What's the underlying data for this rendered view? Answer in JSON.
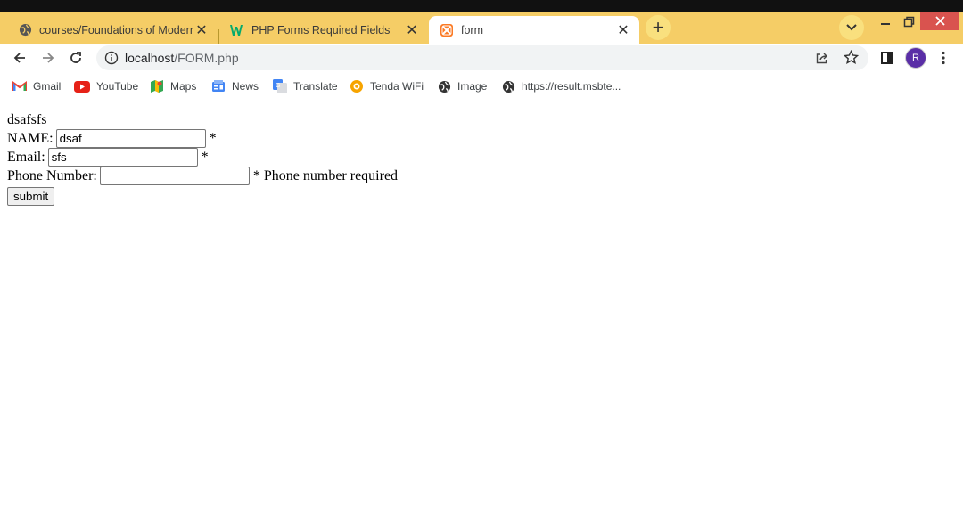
{
  "browser": {
    "tabs": [
      {
        "label": "courses/Foundations of Modern Web",
        "icon": "globe-icon",
        "active": false
      },
      {
        "label": "PHP Forms Required Fields",
        "icon": "w3schools-icon",
        "active": false
      },
      {
        "label": "form",
        "icon": "xampp-icon",
        "active": true
      }
    ],
    "new_tab": "+",
    "url_host": "localhost",
    "url_path": "/FORM.php",
    "profile_initial": "R",
    "colors": {
      "tabstrip": "#f5cd66",
      "close_button": "#d9534f",
      "profile": "#5a2ea6"
    }
  },
  "bookmarks": [
    {
      "label": "Gmail",
      "icon": "gmail-icon"
    },
    {
      "label": "YouTube",
      "icon": "youtube-icon"
    },
    {
      "label": "Maps",
      "icon": "maps-icon"
    },
    {
      "label": "News",
      "icon": "news-icon"
    },
    {
      "label": "Translate",
      "icon": "translate-icon"
    },
    {
      "label": "Tenda WiFi",
      "icon": "tenda-icon"
    },
    {
      "label": "Image",
      "icon": "globe-icon"
    },
    {
      "label": "https://result.msbte...",
      "icon": "globe-icon"
    }
  ],
  "page": {
    "output_text": "dsafsfs",
    "name_label": "NAME:",
    "name_value": "dsaf",
    "name_required": "*",
    "email_label": "Email:",
    "email_value": "sfs",
    "email_required": "*",
    "phone_label": "Phone Number:",
    "phone_value": "",
    "phone_error": "* Phone number required",
    "submit_label": "submit"
  }
}
